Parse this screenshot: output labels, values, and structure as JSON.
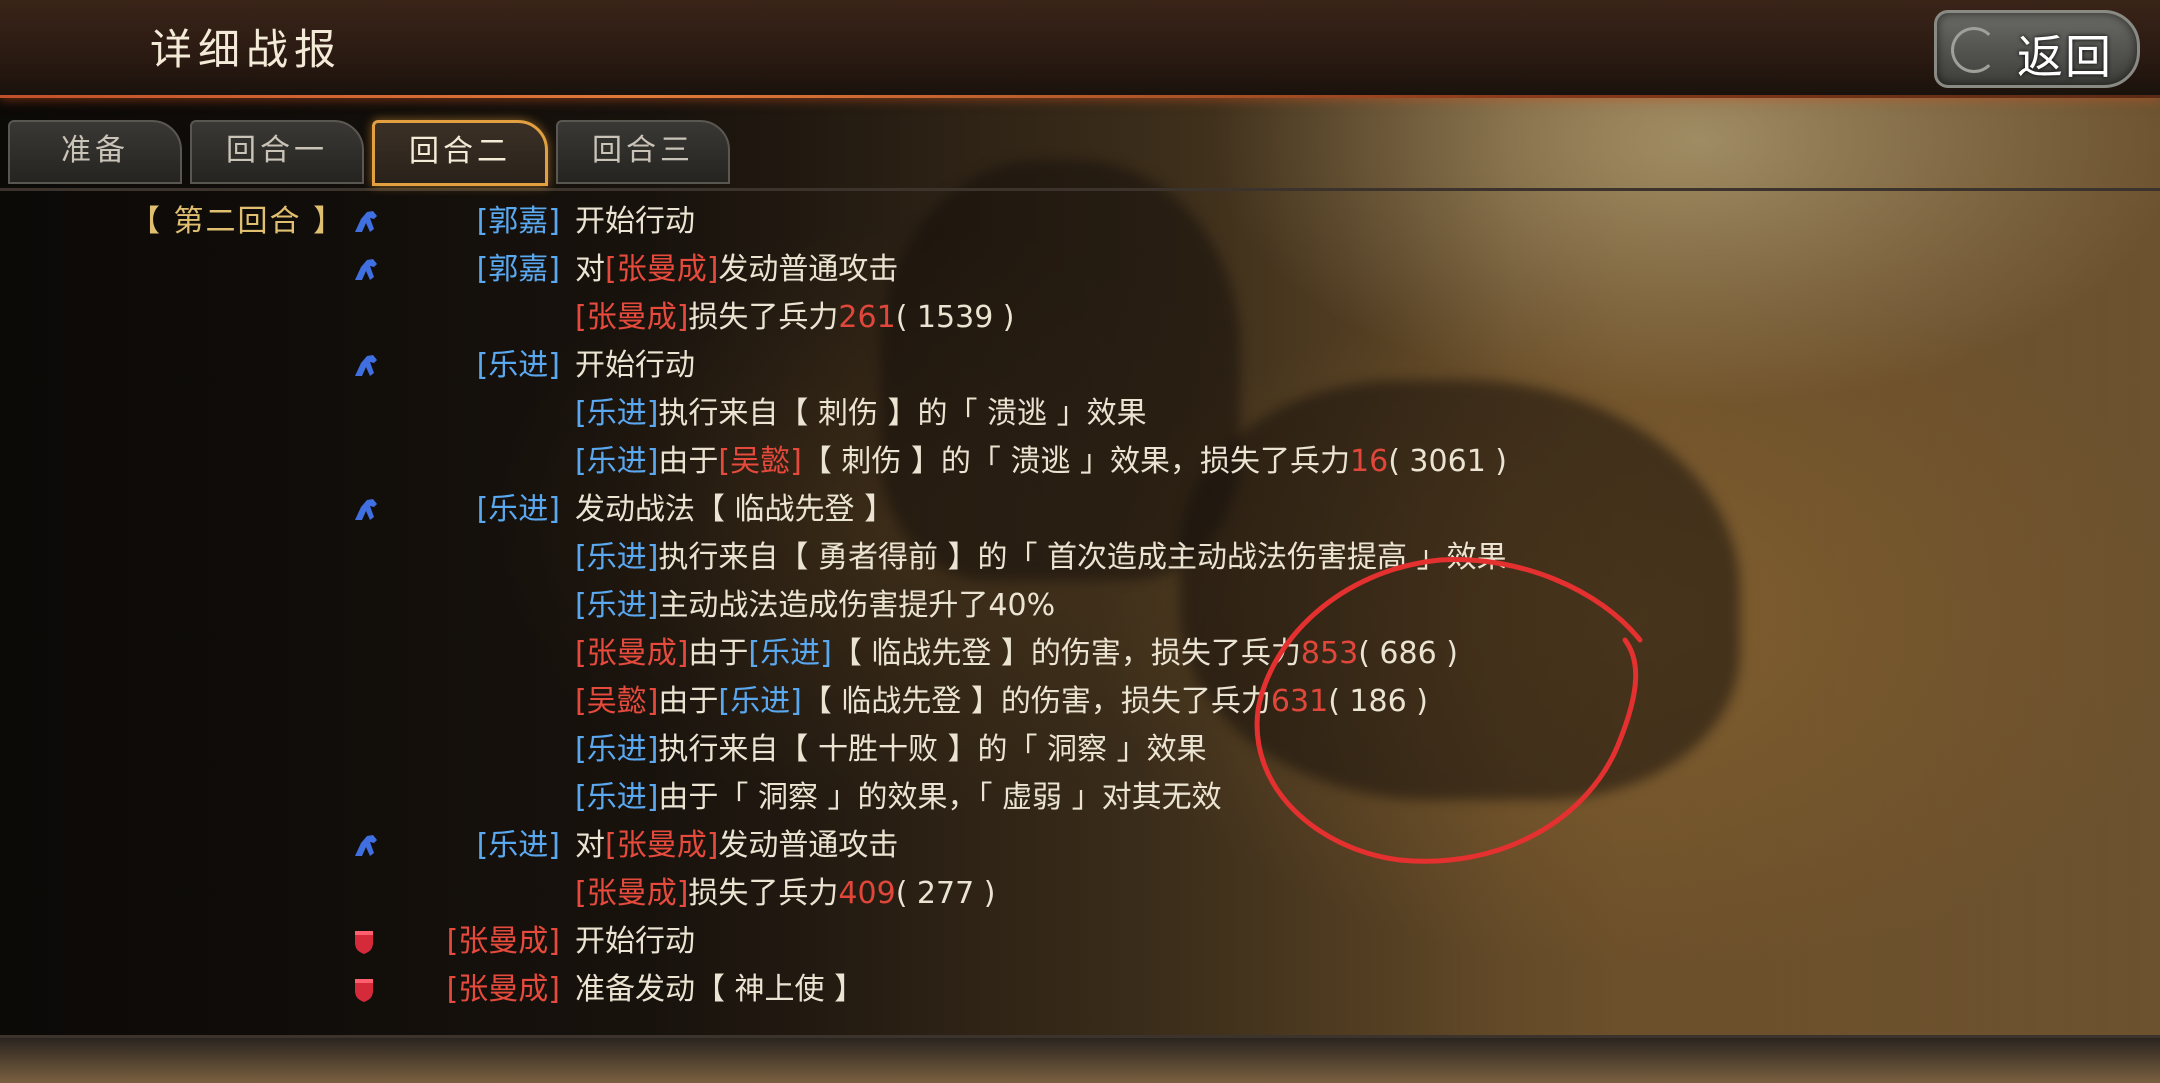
{
  "header": {
    "title": "详细战报",
    "back_label": "返回"
  },
  "tabs": [
    {
      "label": "准备",
      "active": false
    },
    {
      "label": "回合一",
      "active": false
    },
    {
      "label": "回合二",
      "active": true
    },
    {
      "label": "回合三",
      "active": false
    }
  ],
  "round_label": "【 第二回合 】",
  "colors": {
    "friendly": "#5aa8f0",
    "enemy": "#e64a3c",
    "number": "#e0473a",
    "tab_active_border": "#e2a040",
    "annotation": "#e53030"
  },
  "log": {
    "r1": {
      "actor": "[郭嘉]",
      "text": "开始行动"
    },
    "r2": {
      "actor": "[郭嘉]",
      "p1": "对",
      "target": "[张曼成]",
      "p2": "发动普通攻击"
    },
    "r3": {
      "who": "[张曼成]",
      "p1": "损失了兵力",
      "loss": "261",
      "rest": "( 1539 )"
    },
    "r4": {
      "actor": "[乐进]",
      "text": "开始行动"
    },
    "r5": {
      "who": "[乐进]",
      "text": "执行来自【 刺伤 】的「 溃逃 」效果"
    },
    "r6": {
      "who": "[乐进]",
      "p1": "由于",
      "src": "[吴懿]",
      "p2": "【 刺伤 】的「 溃逃 」效果，损失了兵力",
      "loss": "16",
      "rest": "( 3061 )"
    },
    "r7": {
      "actor": "[乐进]",
      "text": "发动战法【 临战先登 】"
    },
    "r8": {
      "who": "[乐进]",
      "text": "执行来自【 勇者得前 】的「 首次造成主动战法伤害提高 」效果"
    },
    "r9": {
      "who": "[乐进]",
      "text": "主动战法造成伤害提升了40%"
    },
    "r10": {
      "who": "[张曼成]",
      "p1": "由于",
      "src": "[乐进]",
      "p2": "【 临战先登 】的伤害，损失了兵力",
      "loss": "853",
      "rest": "( 686 )"
    },
    "r11": {
      "who": "[吴懿]",
      "p1": "由于",
      "src": "[乐进]",
      "p2": "【 临战先登 】的伤害，损失了兵力",
      "loss": "631",
      "rest": "( 186 )"
    },
    "r12": {
      "who": "[乐进]",
      "text": "执行来自【 十胜十败 】的「 洞察 」效果"
    },
    "r13": {
      "who": "[乐进]",
      "text": "由于「 洞察 」的效果，「 虚弱 」对其无效"
    },
    "r14": {
      "actor": "[乐进]",
      "p1": "对",
      "target": "[张曼成]",
      "p2": "发动普通攻击"
    },
    "r15": {
      "who": "[张曼成]",
      "p1": "损失了兵力",
      "loss": "409",
      "rest": "( 277 )"
    },
    "r16": {
      "actor": "[张曼成]",
      "text": "开始行动"
    },
    "r17": {
      "actor": "[张曼成]",
      "text": "准备发动【 神上使 】"
    }
  }
}
